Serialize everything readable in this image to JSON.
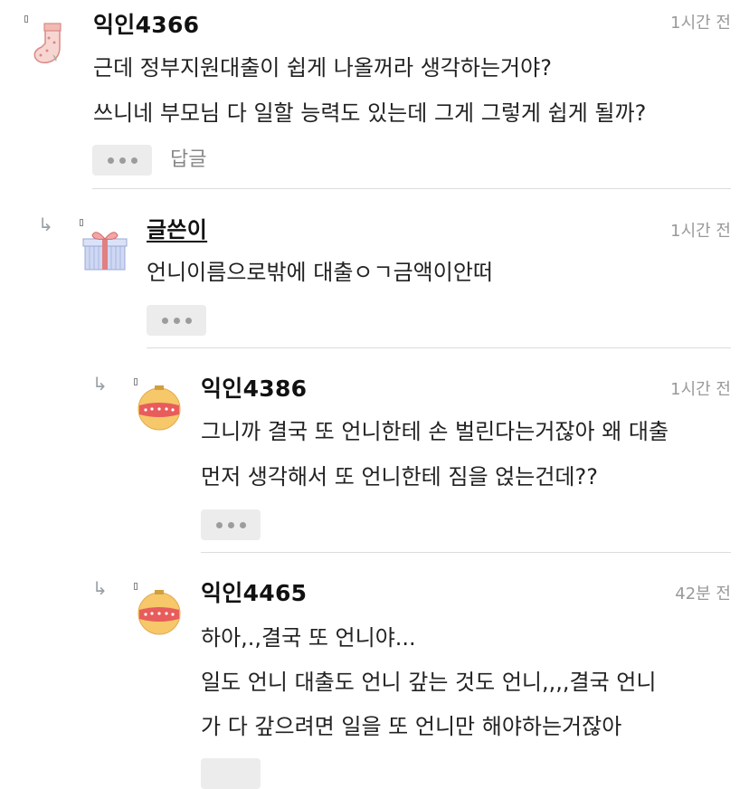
{
  "comments": [
    {
      "author": "익인4366",
      "time": "1시간 전",
      "lines": [
        "근데 정부지원대출이 쉽게 나올꺼라 생각하는거야?",
        "쓰니네 부모님 다 일할 능력도 있는데 그게 그렇게 쉽게 될까?"
      ],
      "reply_label": "답글",
      "avatar": "sock-icon"
    },
    {
      "author": "글쓴이",
      "time": "1시간 전",
      "lines": [
        "언니이름으로밖에 대출ㅇㄱ금액이안떠"
      ],
      "avatar": "gift-icon"
    },
    {
      "author": "익인4386",
      "time": "1시간 전",
      "lines": [
        "그니까 결국 또 언니한테 손 벌린다는거잖아 왜 대출",
        "먼저 생각해서 또 언니한테 짐을 얹는건데??"
      ],
      "avatar": "ornament-icon"
    },
    {
      "author": "익인4465",
      "time": "42분 전",
      "lines": [
        "하아,.,결국 또 언니야...",
        "일도 언니 대출도 언니 갚는 것도 언니,,,,결국 언니",
        "가 다 갚으려면 일을 또 언니만 해야하는거잖아"
      ],
      "avatar": "ornament-icon"
    }
  ],
  "colors": {
    "divider": "#dcdcdc",
    "time": "#999999",
    "button_bg": "#ececec"
  }
}
